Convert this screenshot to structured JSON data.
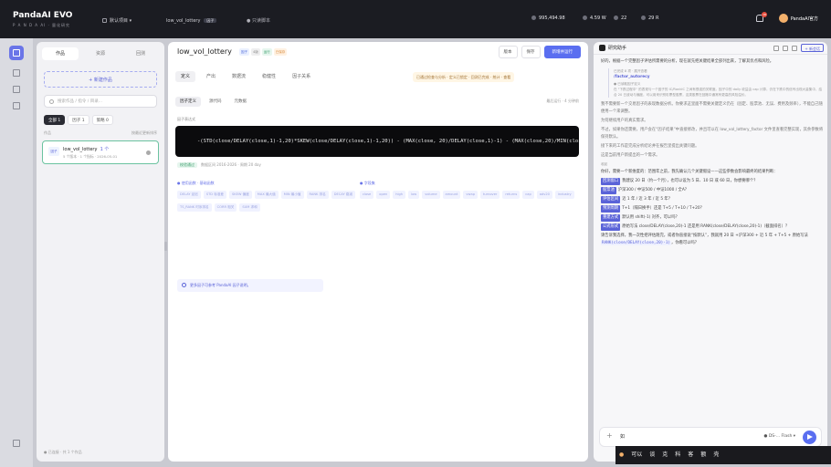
{
  "topbar": {
    "brand": "PandaAI EVO",
    "brand_sub": "P A N D A  AI · 量化研究",
    "default_project": "默认项目",
    "factor_tab": "low_vol_lottery",
    "factor_pill": "因子",
    "custom": "只读脚本",
    "stats": [
      "995,494.98",
      "4.59 W",
      "22",
      "29 R"
    ],
    "notif_count": "18",
    "user": "PandaAI官方"
  },
  "sidebar": {
    "tabs": [
      "作品",
      "资源",
      "回测"
    ],
    "new_button": "+ 新建作品",
    "search_placeholder": "搜索作品 / 指令 / 目录...",
    "filters": [
      "全部 1",
      "因子 1",
      "策略 0"
    ],
    "list_head_left": "作品",
    "list_head_right": "按最近更新排序",
    "card": {
      "badge": "因子",
      "title": "low_vol_lottery",
      "count": "1 个",
      "sub": "5 个版本 · 1 个指标 · 2026-05-01"
    },
    "footer": "● 已连接 · 共 1 个作品"
  },
  "main": {
    "title": "low_vol_lottery",
    "tags": [
      "因子",
      "4版",
      "运行",
      "已保存"
    ],
    "actions": [
      "版本",
      "保存",
      "新增并运行"
    ],
    "tabs": [
      "定义",
      "产出",
      "数据流",
      "稳健性",
      "因子关系"
    ],
    "info_pill": "已通过检查与分析 · 定义已锁定 · 回测已完成 · 统计 · 查看",
    "sub_tabs": [
      "因子定义",
      "源代码",
      "元数据"
    ],
    "sub_right": "最后运行 · 4 分钟前",
    "expr_label": "因子表达式",
    "expression": "-(STD(close/DELAY(close,1)-1,20)*SKEW(close/DELAY(close,1)-1,20)) - (MAX(close, 20)/DELAY(close,1)-1) - (MAX(close,20)/MIN(close,20)",
    "under_code_ok": "校验通过",
    "under_code_rest": "数据区间 2016-2026 · 周期 20 day",
    "section_left": "● 使用函数 · 基础函数",
    "section_right": "● 字段集",
    "chips_left": [
      "DELAY 延迟",
      "STD 标准差",
      "SKEW 偏度",
      "MAX 最大值",
      "MIN 最小值",
      "RANK 排名",
      "DECAY 衰减",
      "TS_RANK 时序排名",
      "CORR 相关",
      "SUM 求和"
    ],
    "chips_right": [
      "close",
      "open",
      "high",
      "low",
      "volume",
      "amount",
      "vwap",
      "turnover",
      "returns",
      "cap",
      "adv20",
      "industry"
    ],
    "hint": "更多因子可参考 PandaAI 因子说明。"
  },
  "chat": {
    "title": "研究助手",
    "new_label": "+ 新会话",
    "messages": {
      "p1": "好的，根据一个完整因子评估所需要的分析，现在就先把关键结果全部列出来，了解其优点和风险。",
      "thought_tag": "已完成 8 项 · 展开查看",
      "quote_title": "/factor_autorecy",
      "quote_sub": "● 已读取因子定义",
      "quote_body": "在 \"下跌过程中\" 的表现与一个因子的 IC/RankIC 之间有很强的关联度。因子中的 daily 收益由 cap 计算，仍在下跌中的信号出现大量集中，结合 20 日波动与偏度，可以用来识别彩票型股票，这类股票在回撤中通常有更高的风险溢价。",
      "p2": "我不需要新一个交易因子的表现数据分析。你要求这里面不需要关键定义仍在（固定、股票池、无误、费用及频率），不能自己随便用一个来调整。",
      "p3": "为何继续用户的真实需求。",
      "p4": "不过，如果你还需要，用户会在“因子结果”中直接修改，并且可以在 low_vol_lottery_factor 文件里查看完整实现，其余参数将保持默认。",
      "p5": "接下来的工作是完成分析结论并在报告里提出关键问题。",
      "p6": "这是当前用户新提出的一个需求。",
      "fold": "收起",
      "p7": "你好，需要一个新维度的：范围年之前，我先确认几个关键假设——这些参数会影响最终的",
      "p7b": "结果判断：",
      "q_items": [
        {
          "label": "回测窗口",
          "text": "我建议 20 日（约一个月），也可以设为 5 日、10 日 或 60 日，你想要哪个？"
        },
        {
          "label": "股票池",
          "text": "沪深300 / 中证500 / 中证1000 / 全A？"
        },
        {
          "label": "评估区间",
          "text": "近 1 年 / 近 3 年 / 近 5 年？"
        },
        {
          "label": "预测周期",
          "text": "T+1（隔日换手）还是 T+5 / T+10 / T+20？"
        },
        {
          "label": "重建方式",
          "text": "默认用 shift(-1) 对齐，可以吗？"
        },
        {
          "label": "公式形式",
          "text": "原始写法 close/DELAY(close,20)-1 还是用 RANK(close/DELAY(close,20)-1)（截面排名）？"
        }
      ],
      "p8": "请告诉我选择，我一次性把评估跑完，或者你直接说“按默认”，我就用 20 日 +沪深300 + 近 5 年 + T+5 + 原始写法",
      "p8_code": "RANK(close/DELAY(close,20)-1)",
      "p8_end": "，你看可以吗？"
    },
    "input_value": "如",
    "model": "● DS-... Flash ▾"
  },
  "ime": {
    "candidates": [
      "可以",
      "谈",
      "克",
      "科",
      "客",
      "额",
      "壳"
    ]
  }
}
